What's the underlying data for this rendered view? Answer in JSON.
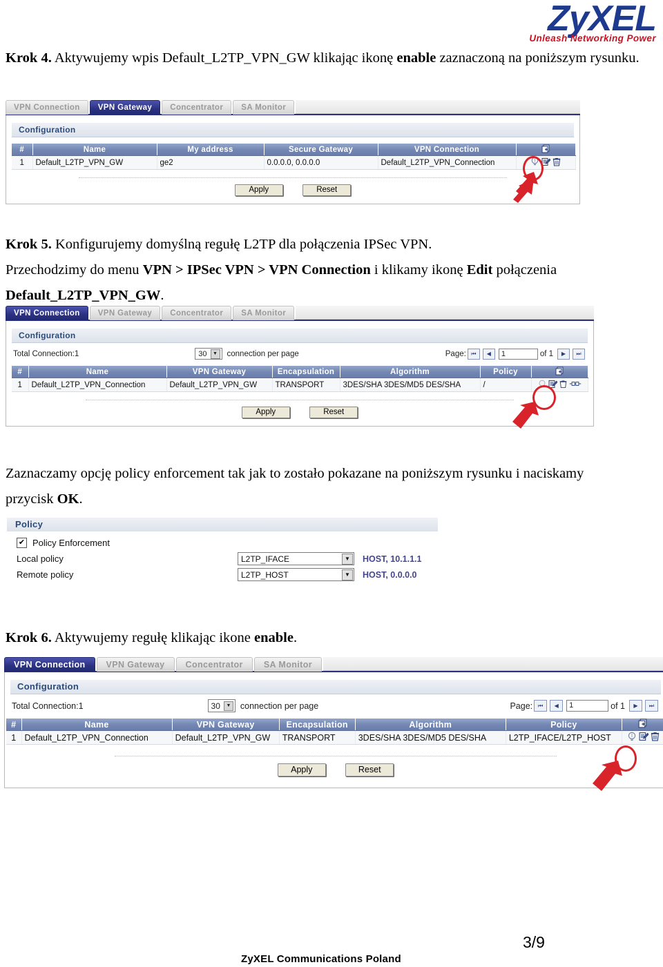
{
  "brand": {
    "logo_text": "ZyXEL",
    "logo_tagline": "Unleash Networking Power",
    "logo_color": "#1d3a8f",
    "tagline_color": "#cc1122"
  },
  "steps": {
    "step4": {
      "label": "Krok 4.",
      "text_before": " Aktywujemy wpis Default_L2TP_VPN_GW klikając ikonę ",
      "bold_word": "enable",
      "text_after": " zaznaczoną na poniższym rysunku."
    },
    "step5": {
      "label": "Krok 5.",
      "line1": " Konfigurujemy domyślną regułę L2TP dla połączenia IPSec VPN.",
      "line2_a": "Przechodzimy do menu ",
      "line2_menu": "VPN > IPSec VPN > VPN Connection",
      "line2_b": " i klikamy ikonę ",
      "line2_bold": "Edit",
      "line2_c": " połączenia",
      "line3_bold": "Default_L2TP_VPN_GW",
      "line3_c": "."
    },
    "policy_note": {
      "line1": "Zaznaczamy opcję policy enforcement tak jak to zostało pokazane na poniższym rysunku i naciskamy",
      "line2_a": "przycisk ",
      "line2_bold": "OK",
      "line2_b": "."
    },
    "step6": {
      "label": "Krok 6.",
      "text_before": " Aktywujemy regułę klikając ikone ",
      "bold_word": "enable",
      "text_after": "."
    }
  },
  "shot1": {
    "tabs": [
      {
        "label": "VPN Connection",
        "active": false
      },
      {
        "label": "VPN Gateway",
        "active": true
      },
      {
        "label": "Concentrator",
        "active": false
      },
      {
        "label": "SA Monitor",
        "active": false
      }
    ],
    "panel_title": "Configuration",
    "columns": [
      "#",
      "Name",
      "My address",
      "Secure Gateway",
      "VPN Connection",
      ""
    ],
    "rows": [
      {
        "num": "1",
        "name": "Default_L2TP_VPN_GW",
        "my_address": "ge2",
        "secure_gateway": "0.0.0.0, 0.0.0.0",
        "vpn_connection": "Default_L2TP_VPN_Connection"
      }
    ],
    "buttons": {
      "apply": "Apply",
      "reset": "Reset"
    },
    "icons": {
      "add": "add-icon",
      "enable": "enable-bulb-icon",
      "edit": "edit-icon",
      "delete": "trash-icon"
    },
    "highlight": "enable-bulb-icon"
  },
  "shot2": {
    "tabs": [
      {
        "label": "VPN Connection",
        "active": true
      },
      {
        "label": "VPN Gateway",
        "active": false
      },
      {
        "label": "Concentrator",
        "active": false
      },
      {
        "label": "SA Monitor",
        "active": false
      }
    ],
    "panel_title": "Configuration",
    "total_label": "Total Connection:1",
    "per_page_value": "30",
    "per_page_label": "connection per page",
    "page_label": "Page:",
    "page_value": "1",
    "page_of": "of 1",
    "columns": [
      "#",
      "Name",
      "VPN Gateway",
      "Encapsulation",
      "Algorithm",
      "Policy",
      ""
    ],
    "rows": [
      {
        "num": "1",
        "name": "Default_L2TP_VPN_Connection",
        "vpn_gateway": "Default_L2TP_VPN_GW",
        "encapsulation": "TRANSPORT",
        "algorithm": "3DES/SHA 3DES/MD5 DES/SHA",
        "policy": "/"
      }
    ],
    "buttons": {
      "apply": "Apply",
      "reset": "Reset"
    },
    "highlight": "edit-icon"
  },
  "policy_panel": {
    "title": "Policy",
    "enforcement_label": "Policy Enforcement",
    "enforcement_checked": true,
    "local_label": "Local policy",
    "local_value": "L2TP_IFACE",
    "local_detail": "HOST, 10.1.1.1",
    "remote_label": "Remote policy",
    "remote_value": "L2TP_HOST",
    "remote_detail": "HOST, 0.0.0.0",
    "detail_color": "#44468f"
  },
  "shot3": {
    "tabs": [
      {
        "label": "VPN Connection",
        "active": true
      },
      {
        "label": "VPN Gateway",
        "active": false
      },
      {
        "label": "Concentrator",
        "active": false
      },
      {
        "label": "SA Monitor",
        "active": false
      }
    ],
    "panel_title": "Configuration",
    "total_label": "Total Connection:1",
    "per_page_value": "30",
    "per_page_label": "connection per page",
    "page_label": "Page:",
    "page_value": "1",
    "page_of": "of 1",
    "columns": [
      "#",
      "Name",
      "VPN Gateway",
      "Encapsulation",
      "Algorithm",
      "Policy",
      ""
    ],
    "rows": [
      {
        "num": "1",
        "name": "Default_L2TP_VPN_Connection",
        "vpn_gateway": "Default_L2TP_VPN_GW",
        "encapsulation": "TRANSPORT",
        "algorithm": "3DES/SHA 3DES/MD5 DES/SHA",
        "policy": "L2TP_IFACE/L2TP_HOST"
      }
    ],
    "buttons": {
      "apply": "Apply",
      "reset": "Reset"
    },
    "highlight": "enable-bulb-icon"
  },
  "footer": {
    "page_number": "3/9",
    "company": "ZyXEL Communications Poland"
  }
}
